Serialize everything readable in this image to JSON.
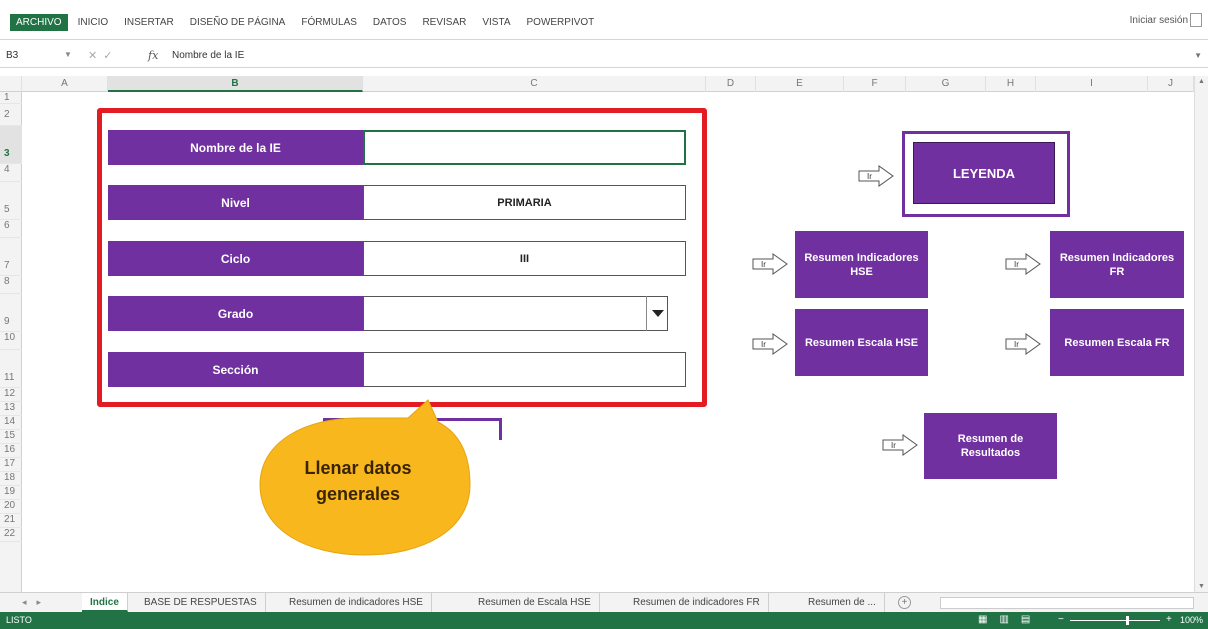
{
  "ribbon": {
    "tabs": [
      "ARCHIVO",
      "INICIO",
      "INSERTAR",
      "DISEÑO DE PÁGINA",
      "FÓRMULAS",
      "DATOS",
      "REVISAR",
      "VISTA",
      "POWERPIVOT"
    ],
    "signin": "Iniciar sesión"
  },
  "formula_bar": {
    "name_box": "B3",
    "fx": "fx",
    "content": "Nombre de la IE"
  },
  "columns": [
    "A",
    "B",
    "C",
    "D",
    "E",
    "F",
    "G",
    "H",
    "I",
    "J"
  ],
  "rows": [
    "1",
    "2",
    "3",
    "4",
    "5",
    "6",
    "7",
    "8",
    "9",
    "10",
    "11",
    "12",
    "13",
    "14",
    "15",
    "16",
    "17",
    "18",
    "19",
    "20",
    "21",
    "22"
  ],
  "form": {
    "fields": [
      {
        "label": "Nombre de la IE",
        "value": ""
      },
      {
        "label": "Nivel",
        "value": "PRIMARIA"
      },
      {
        "label": "Ciclo",
        "value": "III"
      },
      {
        "label": "Grado",
        "value": ""
      },
      {
        "label": "Sección",
        "value": ""
      }
    ]
  },
  "nav": {
    "arrow_label": "Ir",
    "legend": "LEYENDA",
    "resumen_ind_hse": "Resumen Indicadores HSE",
    "resumen_ind_fr": "Resumen Indicadores FR",
    "resumen_esc_hse": "Resumen Escala HSE",
    "resumen_esc_fr": "Resumen Escala FR",
    "resumen_resultados": "Resumen de Resultados"
  },
  "callout": {
    "text": "Llenar datos generales",
    "fill_color": "#f9b71e"
  },
  "sheet_tabs": {
    "tabs": [
      "Indice",
      "BASE DE RESPUESTAS",
      "Resumen de indicadores HSE",
      "Resumen de Escala HSE",
      "Resumen de indicadores FR",
      "Resumen de ..."
    ],
    "active_index": 0
  },
  "status": {
    "ready": "LISTO",
    "zoom": "100%"
  },
  "colors": {
    "accent": "#217346",
    "purple": "#7030a0",
    "red_border": "#e31b23"
  }
}
